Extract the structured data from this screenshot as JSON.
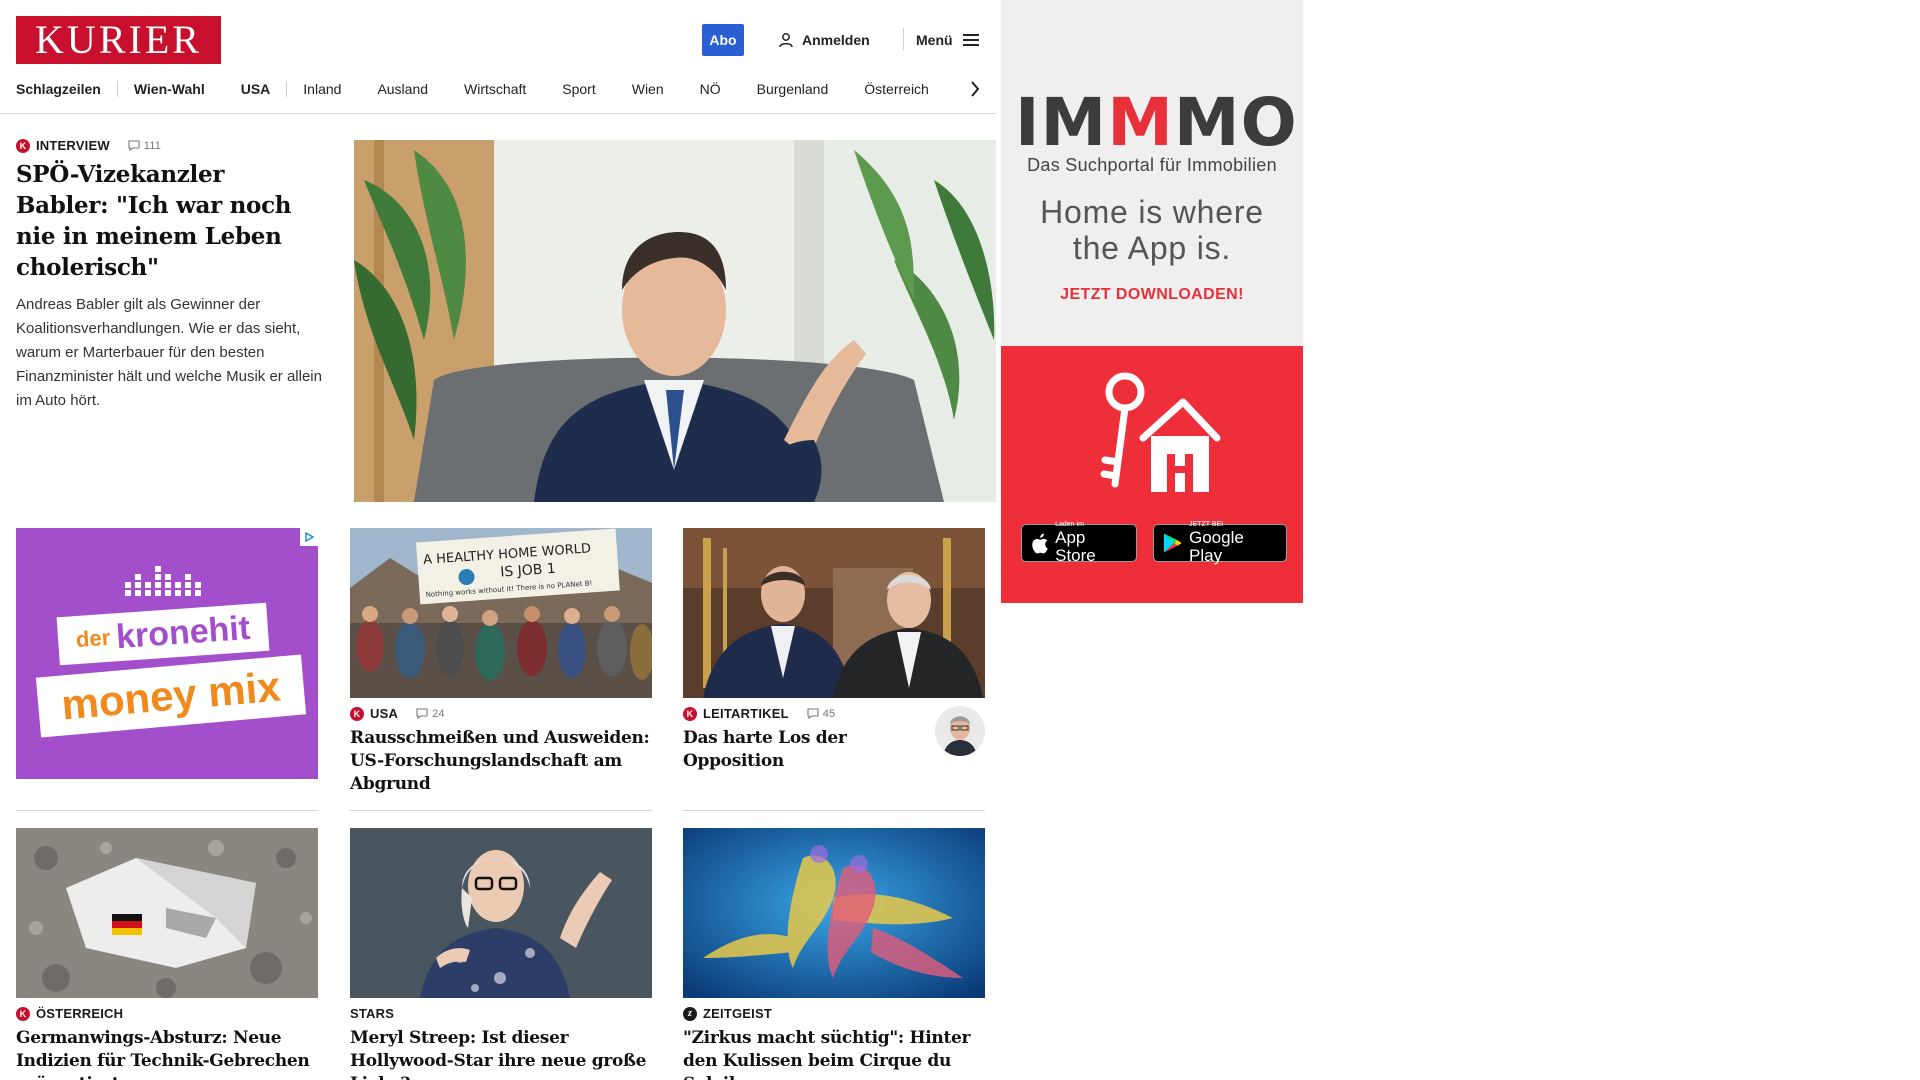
{
  "brand": {
    "logo_text": "KURIER",
    "brand_color": "#c8102e"
  },
  "header": {
    "abo_label": "Abo",
    "login_label": "Anmelden",
    "menu_label": "Menü"
  },
  "nav": {
    "items": [
      "Schlagzeilen",
      "Wien-Wahl",
      "USA",
      "Inland",
      "Ausland",
      "Wirtschaft",
      "Sport",
      "Wien",
      "NÖ",
      "Burgenland",
      "Österreich"
    ]
  },
  "lead_article": {
    "category": "INTERVIEW",
    "comments": "111",
    "headline": "SPÖ-Vizekanzler Babler: \"Ich war noch nie in meinem Leben cholerisch\"",
    "teaser": "Andreas Babler gilt als Gewinner der Koalitionsverhandlungen. Wie er das sieht, warum er Marterbauer für den besten Finanzminister hält und welche Musik er allein im Auto hört."
  },
  "articles": [
    {
      "category": "USA",
      "comments": "24",
      "headline": "Rausschmeißen und Ausweiden: US-Forschungslandschaft am Abgrund",
      "image_text": {
        "line1": "A HEALTHY HOME WORLD",
        "line2": "IS JOB 1",
        "line3": "Nothing works without it!  There is no PLANet B!"
      }
    },
    {
      "category": "LEITARTIKEL",
      "comments": "45",
      "headline": "Das harte Los der Opposition"
    },
    {
      "category": "ÖSTERREICH",
      "headline": "Germanwings-Absturz: Neue Indizien für Technik-Gebrechen präsentiert"
    },
    {
      "category": "STARS",
      "headline": "Meryl Streep: Ist dieser Hollywood-Star ihre neue große Liebe?"
    },
    {
      "category": "ZEITGEIST",
      "headline": "\"Zirkus macht süchtig\": Hinter den Kulissen beim Cirque du Soleil"
    }
  ],
  "ads": {
    "kronehit": {
      "line1": "der",
      "line2": "kronehit",
      "line3": "money mix"
    },
    "immo": {
      "logo_parts": [
        "IM",
        "M",
        "MO"
      ],
      "tagline": "Das Suchportal für Immobilien",
      "slogan_line1": "Home is where",
      "slogan_line2": "the App is.",
      "cta": "JETZT DOWNLOADEN!",
      "appstore_small": "Laden im",
      "appstore_large": "App Store",
      "googleplay_small": "JETZT BEI",
      "googleplay_large": "Google Play",
      "accent": "#e8303a"
    }
  }
}
